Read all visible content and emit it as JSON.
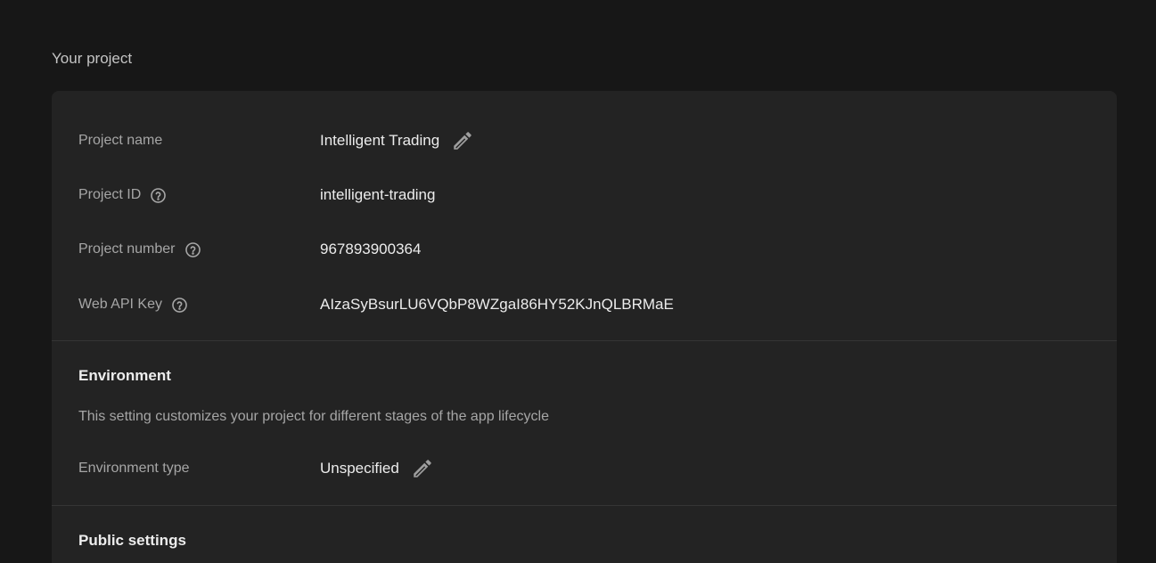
{
  "section": {
    "title": "Your project"
  },
  "project": {
    "name_label": "Project name",
    "name_value": "Intelligent Trading",
    "id_label": "Project ID",
    "id_value": "intelligent-trading",
    "number_label": "Project number",
    "number_value": "967893900364",
    "api_key_label": "Web API Key",
    "api_key_value": "AIzaSyBsurLU6VQbP8WZgaI86HY52KJnQLBRMaE"
  },
  "environment": {
    "title": "Environment",
    "description": "This setting customizes your project for different stages of the app lifecycle",
    "type_label": "Environment type",
    "type_value": "Unspecified"
  },
  "public_settings": {
    "title": "Public settings"
  },
  "icons": {
    "edit": "pencil-icon",
    "help": "help-circle-icon"
  }
}
